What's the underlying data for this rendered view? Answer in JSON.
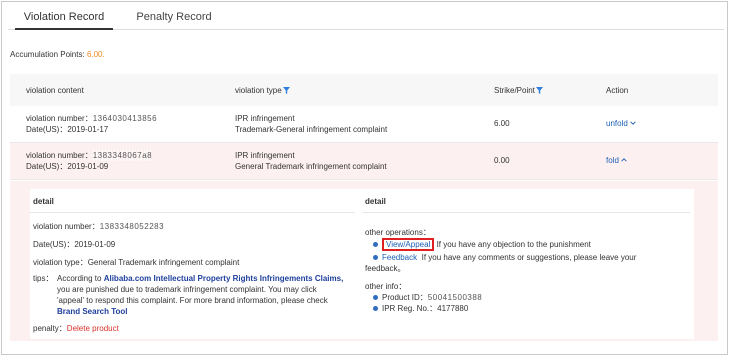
{
  "tabs": {
    "violation_record": "Violation Record",
    "penalty_record": "Penalty Record"
  },
  "accumulation": {
    "label": "Accumulation Points: ",
    "value": "6.00."
  },
  "table": {
    "headers": {
      "content": "violation content",
      "type": "violation type",
      "strike": "Strike/Point",
      "action": "Action"
    },
    "rows": [
      {
        "number_label": "violation number：",
        "number_value": "1364030413856",
        "date": "Date(US)：2019-01-17",
        "type_line1": "IPR infringement",
        "type_line2": "Trademark-General infringement complaint",
        "points": "6.00",
        "action": "unfold"
      },
      {
        "number_label": "violation number：",
        "number_value": "1383348067a8",
        "date": "Date(US)：2019-01-09",
        "type_line1": "IPR infringement",
        "type_line2": "General Trademark infringement complaint",
        "points": "0.00",
        "action": "fold"
      }
    ]
  },
  "detail": {
    "left_title": "detail",
    "number_label": "violation number：",
    "number_value": "1383348052283",
    "date": "Date(US)：2019-01-09",
    "type": "violation type：General Trademark infringement complaint",
    "tips_label": "tips：",
    "tips_prefix": "According to ",
    "tips_link": "Alibaba.com Intellectual Property Rights Infringements Claims,",
    "tips_line2": "you are punished due to trademark infringement complaint. You may click",
    "tips_line3": "'appeal' to respond this complaint. For more brand information, please check",
    "brand_link": "Brand Search Tool",
    "penalty_label": "penalty：",
    "penalty_value": "Delete product",
    "right_title": "detail",
    "other_operations": "other operations：",
    "view_appeal": "View/Appeal",
    "view_appeal_text": "If you have any objection to the punishment",
    "feedback": "Feedback",
    "feedback_text": "If you have any comments or suggestions, please leave your",
    "feedback_text2": "feedback。",
    "other_info": "other info：",
    "product_id_label": "Product ID：",
    "product_id_value": "50041500388",
    "ipr_label": "IPR Reg. No.：",
    "ipr_value": "4177880"
  },
  "colors": {
    "accent_link": "#1e5fb4",
    "points_orange": "#f08a24",
    "expanded_row_bg": "#fdf0f0",
    "highlight_box": "#e02020"
  }
}
